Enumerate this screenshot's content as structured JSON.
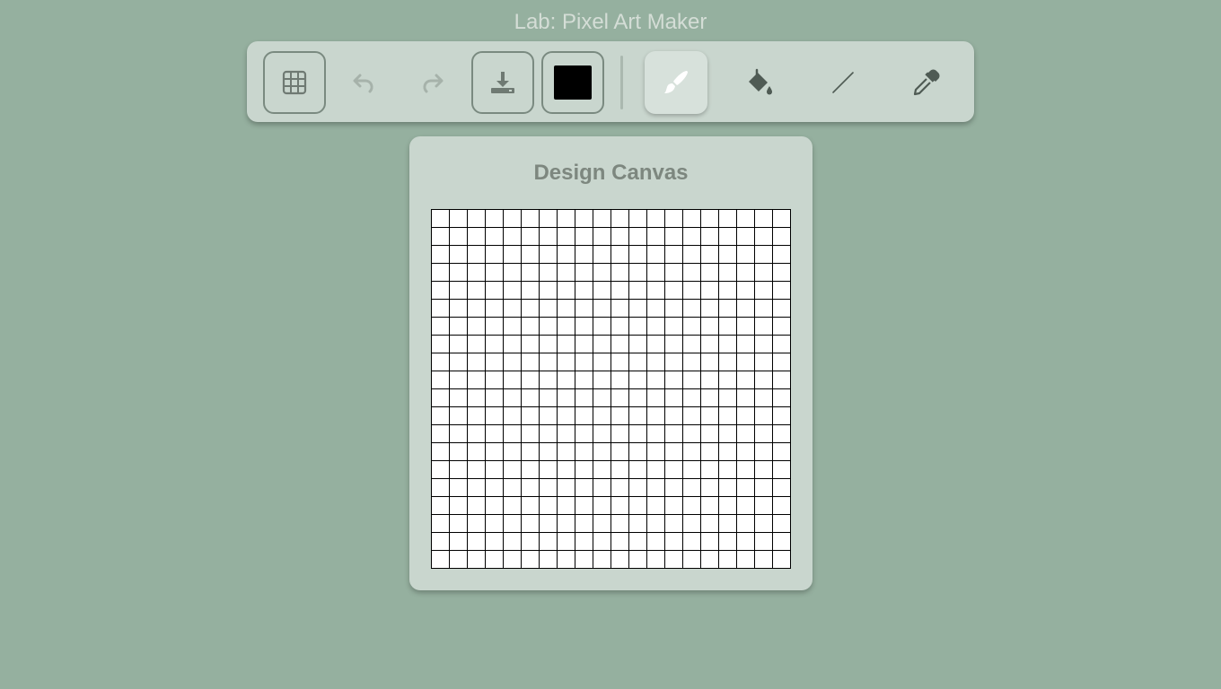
{
  "app": {
    "title": "Lab: Pixel Art Maker"
  },
  "toolbar": {
    "buttons": [
      {
        "id": "grid-toggle",
        "icon": "grid-icon",
        "state": "enabled"
      },
      {
        "id": "undo",
        "icon": "undo-icon",
        "state": "disabled"
      },
      {
        "id": "redo",
        "icon": "redo-icon",
        "state": "disabled"
      },
      {
        "id": "download",
        "icon": "download-icon",
        "state": "enabled"
      },
      {
        "id": "color-picker",
        "icon": "color-swatch",
        "state": "enabled"
      },
      {
        "id": "brush",
        "icon": "paintbrush-icon",
        "state": "active"
      },
      {
        "id": "fill",
        "icon": "paint-bucket-icon",
        "state": "enabled"
      },
      {
        "id": "line",
        "icon": "line-icon",
        "state": "enabled"
      },
      {
        "id": "eyedropper",
        "icon": "eyedropper-icon",
        "state": "enabled"
      }
    ],
    "current_color": "#000000"
  },
  "canvas": {
    "title": "Design Canvas",
    "rows": 20,
    "columns": 20,
    "cell_color": "#ffffff",
    "grid_line_color": "#000000"
  },
  "colors": {
    "background": "#95b09f",
    "panel": "#c9d6ce",
    "icon": "#6f7a73",
    "icon_disabled": "#a6b2aa"
  }
}
